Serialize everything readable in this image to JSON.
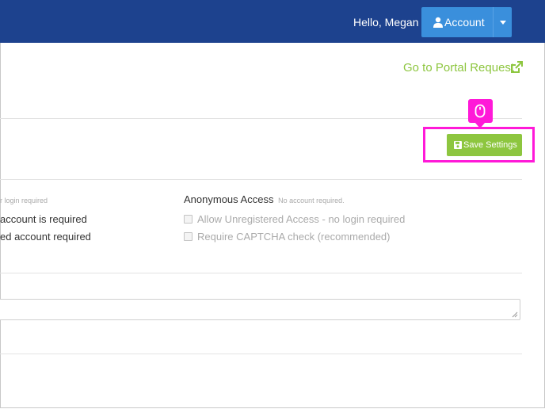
{
  "header": {
    "greeting": "Hello, Megan",
    "account_label": "Account",
    "account_icon": "user-icon",
    "dropdown_icon": "caret-down-icon"
  },
  "portal_link": {
    "label": "Go to Portal Request",
    "icon": "external-link-icon"
  },
  "toolbar": {
    "save_label": "Save Settings",
    "save_icon": "floppy-disk-icon"
  },
  "cursor_indicator": {
    "icon": "mouse-icon"
  },
  "access": {
    "left_fragment_sub": "r login required",
    "left_option_1": "account is required",
    "left_option_2": "ed account required",
    "anonymous_title": "Anonymous Access",
    "anonymous_sub": "No account required.",
    "anonymous_options": [
      {
        "label": "Allow Unregistered Access - no login required",
        "checked": false
      },
      {
        "label": "Require CAPTCHA check (recommended)",
        "checked": false
      }
    ]
  },
  "colors": {
    "header_bg": "#1d428e",
    "account_btn": "#3a8fdc",
    "accent_green": "#8dc63f",
    "highlight_magenta": "#ff19d8"
  }
}
